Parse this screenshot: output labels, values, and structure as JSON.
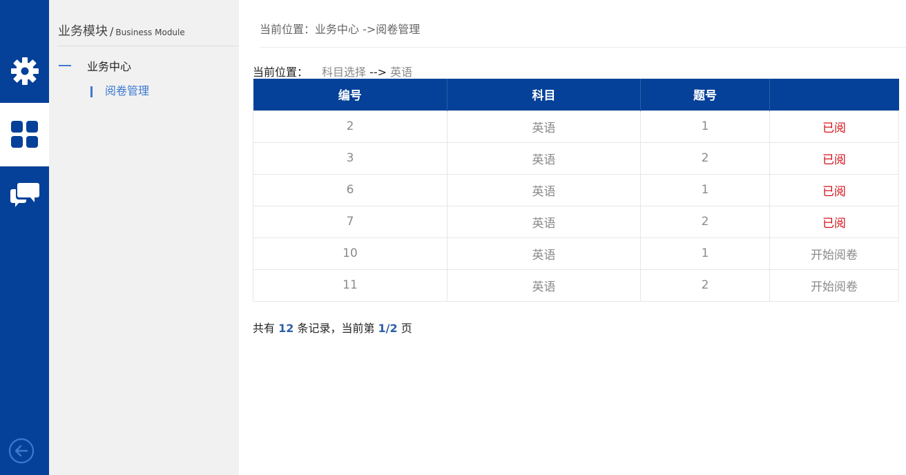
{
  "rail": {
    "items": [
      {
        "name": "settings",
        "icon": "gear-icon",
        "active": false
      },
      {
        "name": "modules",
        "icon": "grid-icon",
        "active": true
      },
      {
        "name": "messages",
        "icon": "chat-icon",
        "active": false
      }
    ],
    "back_icon": "arrow-left-circle-icon",
    "color": "#054198"
  },
  "sidebar": {
    "title": "业务模块",
    "slash": "/",
    "subtitle": "Business Module",
    "group_label": "业务中心",
    "item_label": "阅卷管理"
  },
  "header": {
    "breadcrumb": "当前位置：业务中心 ->阅卷管理"
  },
  "content": {
    "crumb_label": "当前位置：",
    "crumb_path": "科目选择",
    "crumb_arrow": " --> ",
    "crumb_subject": "英语"
  },
  "table": {
    "headers": [
      "编号",
      "科目",
      "题号",
      ""
    ],
    "rows": [
      {
        "id": "2",
        "subject": "英语",
        "qno": "1",
        "action": "已阅",
        "status": "read"
      },
      {
        "id": "3",
        "subject": "英语",
        "qno": "2",
        "action": "已阅",
        "status": "read"
      },
      {
        "id": "6",
        "subject": "英语",
        "qno": "1",
        "action": "已阅",
        "status": "read"
      },
      {
        "id": "7",
        "subject": "英语",
        "qno": "2",
        "action": "已阅",
        "status": "read"
      },
      {
        "id": "10",
        "subject": "英语",
        "qno": "1",
        "action": "开始阅卷",
        "status": "start"
      },
      {
        "id": "11",
        "subject": "英语",
        "qno": "2",
        "action": "开始阅卷",
        "status": "start"
      }
    ]
  },
  "pager": {
    "prefix": "共有 ",
    "total": "12",
    "middle": " 条记录，当前第 ",
    "page": "1/2",
    "suffix": " 页"
  },
  "colors": {
    "brand": "#054198",
    "link": "#3d7ad0",
    "read": "#d0121b"
  }
}
